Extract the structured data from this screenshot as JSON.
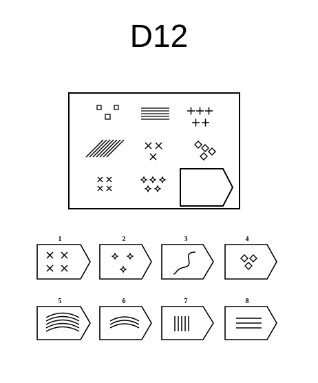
{
  "title": "D12",
  "matrix": {
    "cells": [
      {
        "pattern": "small-squares"
      },
      {
        "pattern": "horizontal-lines"
      },
      {
        "pattern": "plus-signs"
      },
      {
        "pattern": "slanted-lines"
      },
      {
        "pattern": "x-marks"
      },
      {
        "pattern": "diamonds"
      },
      {
        "pattern": "small-x-marks"
      },
      {
        "pattern": "four-point-stars"
      },
      {
        "pattern": "missing"
      }
    ]
  },
  "options": [
    {
      "number": "1",
      "pattern": "x-marks"
    },
    {
      "number": "2",
      "pattern": "four-point-stars"
    },
    {
      "number": "3",
      "pattern": "curved-line"
    },
    {
      "number": "4",
      "pattern": "diamonds"
    },
    {
      "number": "5",
      "pattern": "curved-arcs"
    },
    {
      "number": "6",
      "pattern": "curved-arcs"
    },
    {
      "number": "7",
      "pattern": "vertical-lines"
    },
    {
      "number": "8",
      "pattern": "horizontal-lines"
    }
  ]
}
